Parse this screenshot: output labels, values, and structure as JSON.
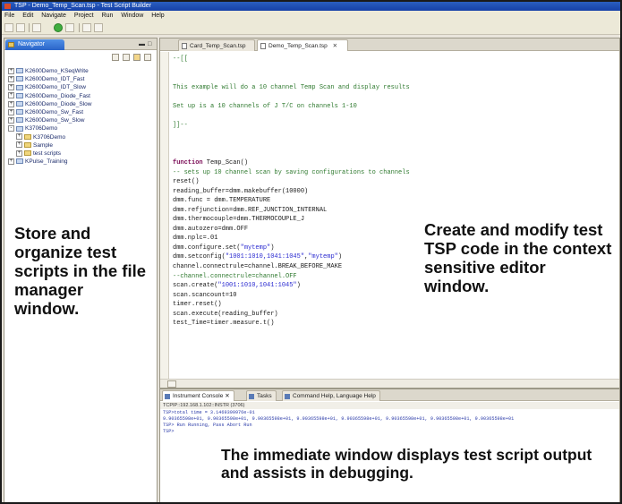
{
  "window": {
    "title": "TSP - Demo_Temp_Scan.tsp - Test Script Builder"
  },
  "menu": [
    "File",
    "Edit",
    "Navigate",
    "Project",
    "Run",
    "Window",
    "Help"
  ],
  "file_manager": {
    "tab_label": "Navigator",
    "tree": [
      {
        "label": "K2600Demo_KSeqWrite",
        "expander": "+",
        "level": 0,
        "kind": "project"
      },
      {
        "label": "K2600Demo_IDT_Fast",
        "expander": "+",
        "level": 0,
        "kind": "project"
      },
      {
        "label": "K2600Demo_IDT_Slow",
        "expander": "+",
        "level": 0,
        "kind": "project"
      },
      {
        "label": "K2600Demo_Diode_Fast",
        "expander": "+",
        "level": 0,
        "kind": "project"
      },
      {
        "label": "K2600Demo_Diode_Slow",
        "expander": "+",
        "level": 0,
        "kind": "project"
      },
      {
        "label": "K2600Demo_Sw_Fast",
        "expander": "+",
        "level": 0,
        "kind": "project"
      },
      {
        "label": "K2600Demo_Sw_Slow",
        "expander": "+",
        "level": 0,
        "kind": "project"
      },
      {
        "label": "K3706Demo",
        "expander": "-",
        "level": 0,
        "kind": "project"
      },
      {
        "label": "K3706Demo",
        "expander": "+",
        "level": 1,
        "kind": "folder"
      },
      {
        "label": "Sample",
        "expander": "+",
        "level": 1,
        "kind": "folder"
      },
      {
        "label": "test scripts",
        "expander": "+",
        "level": 1,
        "kind": "folder"
      },
      {
        "label": "KPulse_Training",
        "expander": "+",
        "level": 0,
        "kind": "project"
      }
    ]
  },
  "editor": {
    "tabs": [
      {
        "label": "Card_Temp_Scan.tsp",
        "active": false
      },
      {
        "label": "Demo_Temp_Scan.tsp",
        "active": true
      }
    ],
    "lines": [
      [
        {
          "t": "--[[",
          "c": "cm"
        }
      ],
      [
        {
          "t": "",
          "c": ""
        }
      ],
      [
        {
          "t": "",
          "c": ""
        }
      ],
      [
        {
          "t": "This example will do a 10 channel Temp Scan and display results",
          "c": "cm"
        }
      ],
      [
        {
          "t": "",
          "c": ""
        }
      ],
      [
        {
          "t": "Set up is a 10 channels of J T/C on channels 1-10",
          "c": "cm"
        }
      ],
      [
        {
          "t": "",
          "c": ""
        }
      ],
      [
        {
          "t": "]]--",
          "c": "cm"
        }
      ],
      [
        {
          "t": "",
          "c": ""
        }
      ],
      [
        {
          "t": "",
          "c": ""
        }
      ],
      [
        {
          "t": "",
          "c": ""
        }
      ],
      [
        {
          "t": "function",
          "c": "kw"
        },
        {
          "t": " Temp_Scan()",
          "c": ""
        }
      ],
      [
        {
          "t": "-- sets up 10 channel scan by saving configurations to channels",
          "c": "cm"
        }
      ],
      [
        {
          "t": "reset()",
          "c": ""
        }
      ],
      [
        {
          "t": "reading_buffer=dmm.makebuffer(10000)",
          "c": ""
        }
      ],
      [
        {
          "t": "dmm.func = dmm.TEMPERATURE",
          "c": ""
        }
      ],
      [
        {
          "t": "dmm.refjunction=dmm.REF_JUNCTION_INTERNAL",
          "c": ""
        }
      ],
      [
        {
          "t": "dmm.thermocouple=dmm.THERMOCOUPLE_J",
          "c": ""
        }
      ],
      [
        {
          "t": "dmm.autozero=dmm.OFF",
          "c": ""
        }
      ],
      [
        {
          "t": "dmm.nplc=.01",
          "c": ""
        }
      ],
      [
        {
          "t": "dmm.configure.set(",
          "c": ""
        },
        {
          "t": "\"mytemp\"",
          "c": "st"
        },
        {
          "t": ")",
          "c": ""
        }
      ],
      [
        {
          "t": "dmm.setconfig(",
          "c": ""
        },
        {
          "t": "\"1001:1010,1041:1045\"",
          "c": "st"
        },
        {
          "t": ",",
          "c": ""
        },
        {
          "t": "\"mytemp\"",
          "c": "st"
        },
        {
          "t": ")",
          "c": ""
        }
      ],
      [
        {
          "t": "channel.connectrule=channel.BREAK_BEFORE_MAKE",
          "c": ""
        }
      ],
      [
        {
          "t": "--channel.connectrule=channel.OFF",
          "c": "cm"
        }
      ],
      [
        {
          "t": "scan.create(",
          "c": ""
        },
        {
          "t": "\"1001:1010,1041:1045\"",
          "c": "st"
        },
        {
          "t": ")",
          "c": ""
        }
      ],
      [
        {
          "t": "scan.scancount=10",
          "c": ""
        }
      ],
      [
        {
          "t": "timer.reset()",
          "c": ""
        }
      ],
      [
        {
          "t": "scan.execute(reading_buffer)",
          "c": ""
        }
      ],
      [
        {
          "t": "test_Time=timer.measure.t()",
          "c": ""
        }
      ]
    ]
  },
  "console": {
    "tabs": [
      {
        "label": "Instrument Console",
        "active": true
      },
      {
        "label": "Tasks",
        "active": false
      },
      {
        "label": "Command Help, Language Help",
        "active": false
      }
    ],
    "header": "TCPIP::192.168.1.102::INSTR (3706)",
    "lines": [
      "TSP>total time = 3.1469399976e-01",
      "9.90365598e+01, 9.90365598e+01, 9.90365598e+01, 9.90365598e+01, 9.90365598e+01, 9.90365598e+01, 9.90365598e+01, 9.90365598e+01",
      "TSP> Run Running, Pass Abort Run",
      "TSP>"
    ]
  },
  "captions": {
    "left": "Store and organize test scripts in the file manager window.",
    "right": "Create and modify test TSP code in the context sensitive editor window.",
    "bottom": "The immediate window displays test script output and assists in debugging."
  }
}
